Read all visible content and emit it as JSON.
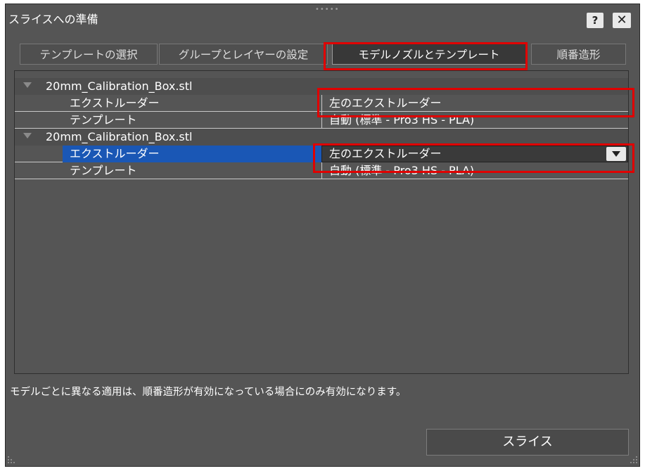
{
  "window": {
    "title": "スライスへの準備",
    "help_label": "?",
    "close_label": "✕"
  },
  "tabs": [
    {
      "label": "テンプレートの選択"
    },
    {
      "label": "グループとレイヤーの設定"
    },
    {
      "label": "モデルノズルとテンプレート",
      "active": true
    },
    {
      "label": "順番造形"
    }
  ],
  "models": [
    {
      "name": "20mm_Calibration_Box.stl",
      "extruder_label": "エクストルーダー",
      "extruder_value": "左のエクストルーダー",
      "template_label": "テンプレート",
      "template_value": "自動 (標準 - Pro3 HS - PLA)"
    },
    {
      "name": "20mm_Calibration_Box.stl",
      "extruder_label": "エクストルーダー",
      "extruder_value": "左のエクストルーダー",
      "template_label": "テンプレート",
      "template_value": "自動 (標準 - Pro3 HS - PLA)"
    }
  ],
  "note": "モデルごとに異なる適用は、順番造形が有効になっている場合にのみ有効になります。",
  "slice_button": "スライス",
  "colors": {
    "background": "#555555",
    "selection": "#1a57b5",
    "highlight_box": "#e00000",
    "active_tab": "#383838"
  }
}
